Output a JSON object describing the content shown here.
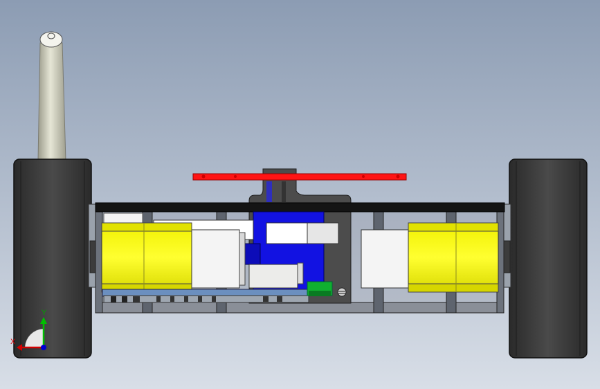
{
  "triad": {
    "x_label": "X",
    "y_label": "Y",
    "x_color": "#d40000",
    "y_color": "#00c000",
    "z_color": "#0000d0"
  },
  "colors": {
    "background_top": "#8d9db4",
    "background_bottom": "#d6dce6",
    "tire": "#3a3a3a",
    "motor": "#ffff00",
    "frame": "#111111",
    "servo_horn": "#ff1a1a",
    "board_blue": "#1010e0",
    "connector_green": "#10b030"
  }
}
